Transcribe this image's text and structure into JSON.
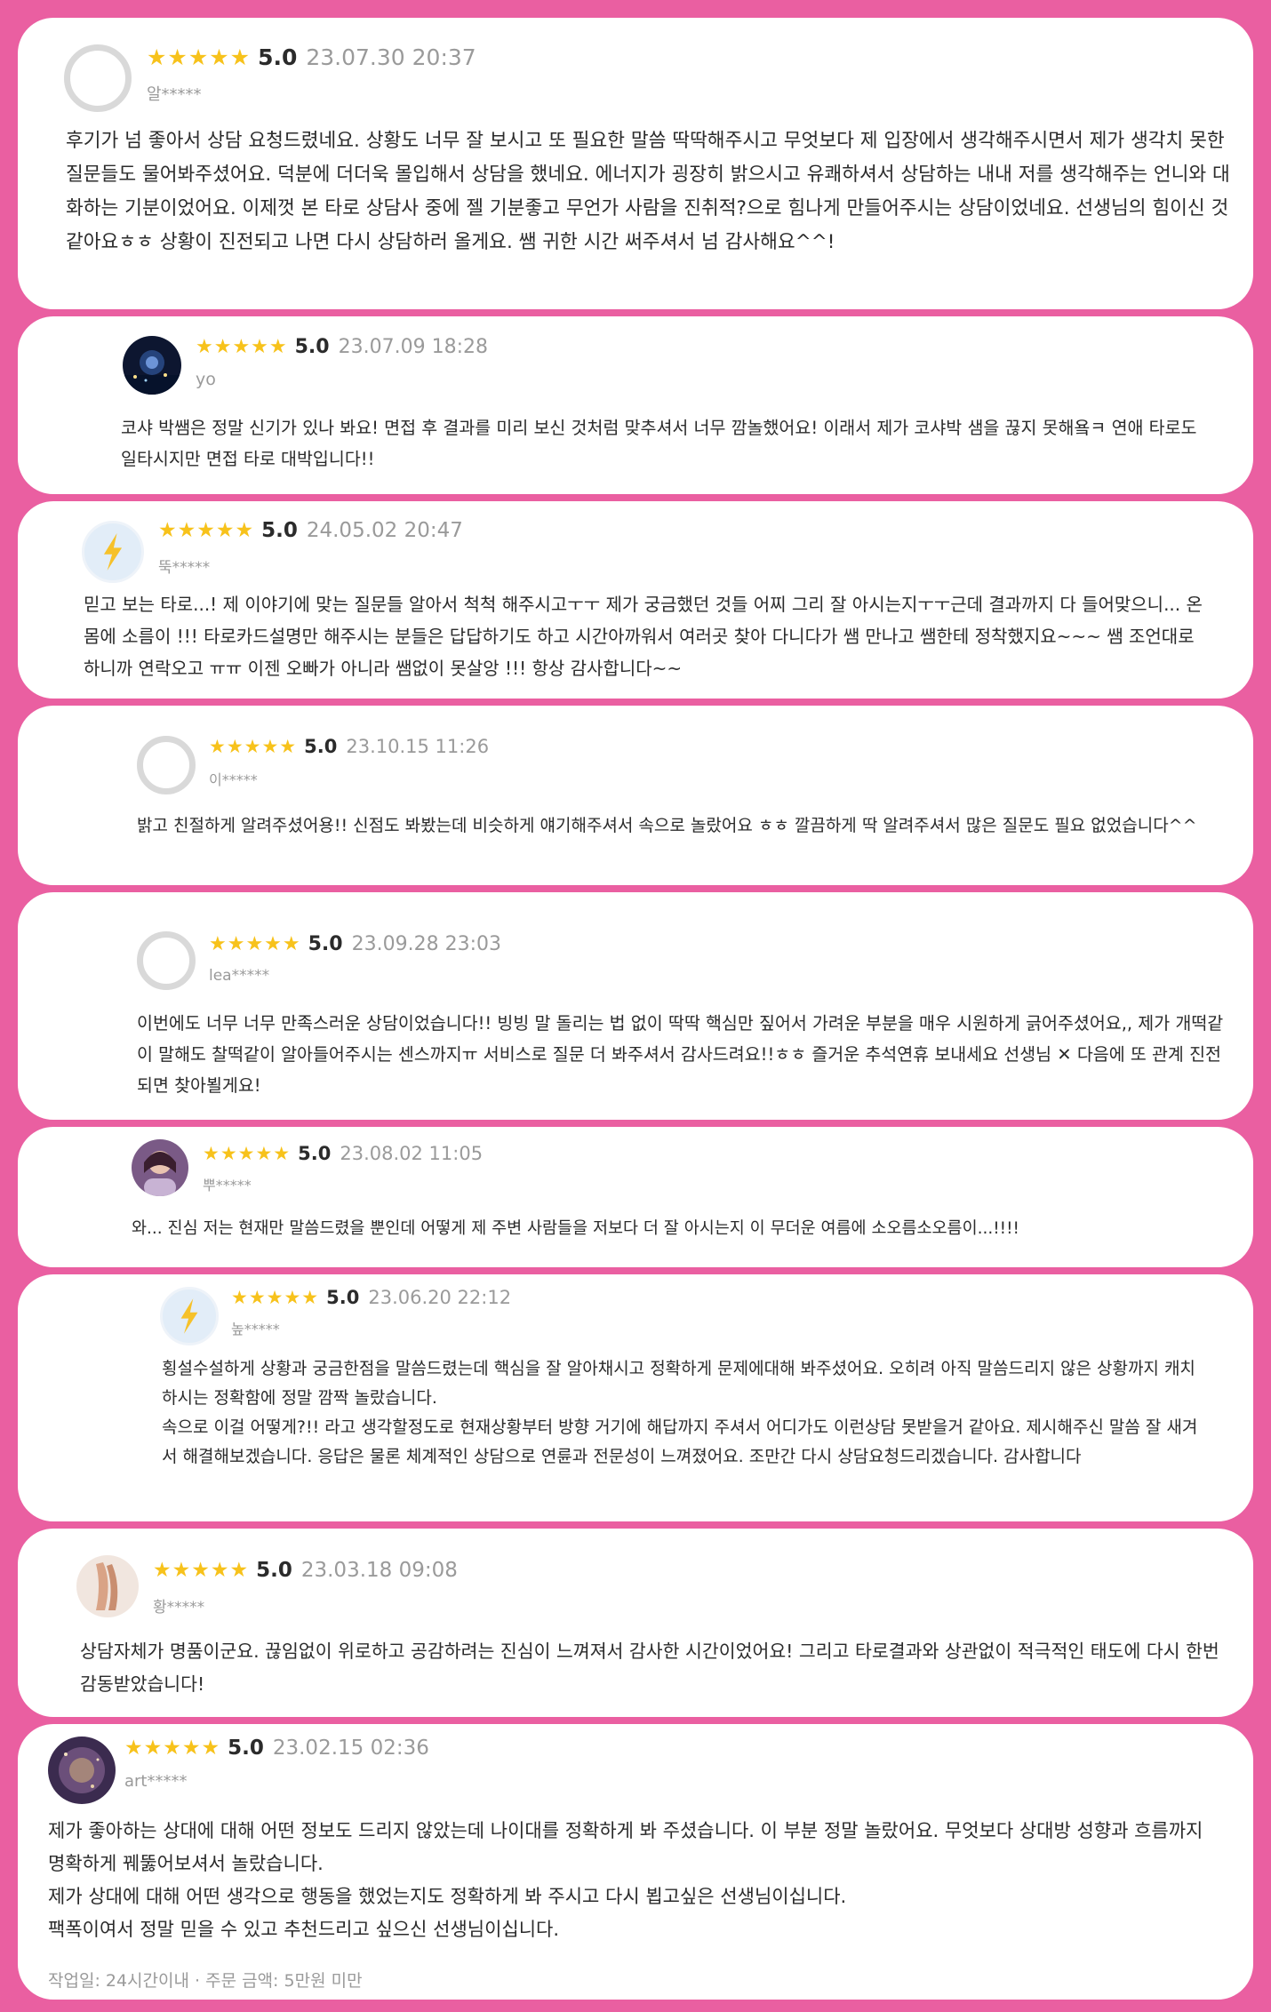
{
  "colors": {
    "page_background": "#ea5fa1",
    "card_background": "#ffffff",
    "star_color": "#f7c21b",
    "meta_gray": "#9a9a9a"
  },
  "reviews": [
    {
      "stars": "★★★★★",
      "rating": "5.0",
      "date": "23.07.30 20:37",
      "user": "알*****",
      "avatar": "default-avatar-icon",
      "text": "후기가 넘 좋아서 상담 요청드렸네요. 상황도 너무 잘 보시고 또 필요한 말씀 딱딱해주시고 무엇보다 제 입장에서 생각해주시면서 제가 생각치 못한 질문들도 물어봐주셨어요. 덕분에 더더욱 몰입해서 상담을 했네요. 에너지가 굉장히 밝으시고 유쾌하셔서 상담하는 내내 저를 생각해주는 언니와 대화하는 기분이었어요. 이제껏 본 타로 상담사 중에 젤 기분좋고 무언가 사람을 진취적?으로 힘나게 만들어주시는 상담이었네요. 선생님의 힘이신 것 같아요ㅎㅎ 상황이 진전되고 나면 다시 상담하러 올게요. 쌤 귀한 시간 써주셔서 넘 감사해요^^!"
    },
    {
      "stars": "★★★★★",
      "rating": "5.0",
      "date": "23.07.09 18:28",
      "user": "yo",
      "avatar": "night-city-photo-avatar",
      "text": "코샤 박쌤은 정말 신기가 있나 봐요! 면접 후 결과를 미리 보신 것처럼 맞추셔서 너무 깜놀했어요! 이래서 제가 코샤박 샘을 끊지 못해욬ㅋ 연애 타로도 일타시지만 면접 타로 대박입니다!!"
    },
    {
      "stars": "★★★★★",
      "rating": "5.0",
      "date": "24.05.02 20:47",
      "user": "뚝*****",
      "avatar": "lightning-bolt-icon",
      "text": "믿고 보는 타로...! 제 이야기에 맞는 질문들 알아서 척척 해주시고ㅜㅜ 제가 궁금했던 것들 어찌 그리 잘 아시는지ㅜㅜ근데 결과까지 다 들어맞으니... 온몸에 소름이 !!! 타로카드설명만 해주시는 분들은 답답하기도 하고 시간아까워서 여러곳 찾아 다니다가 쌤 만나고 쌤한테 정착했지요~~~ 쌤 조언대로 하니까 연락오고 ㅠㅠ 이젠 오빠가 아니라 쌤없이 못살앙 !!! 항상 감사합니다~~"
    },
    {
      "stars": "★★★★★",
      "rating": "5.0",
      "date": "23.10.15 11:26",
      "user": "이*****",
      "avatar": "default-avatar-icon",
      "text": "밝고 친절하게 알려주셨어용!! 신점도 봐봤는데 비슷하게 얘기해주셔서 속으로 놀랐어요 ㅎㅎ 깔끔하게 딱 알려주셔서 많은 질문도 필요 없었습니다^^"
    },
    {
      "stars": "★★★★★",
      "rating": "5.0",
      "date": "23.09.28 23:03",
      "user": "lea*****",
      "avatar": "default-avatar-icon",
      "text": "이번에도 너무 너무 만족스러운 상담이었습니다!! 빙빙 말 돌리는 법 없이 딱딱 핵심만 짚어서 가려운 부분을 매우 시원하게 긁어주셨어요,, 제가 개떡같이 말해도 찰떡같이 알아들어주시는 센스까지ㅠ 서비스로 질문 더 봐주셔서 감사드려요!!ㅎㅎ 즐거운 추석연휴 보내세요 선생님 ✕ 다음에 또 관계 진전되면 찾아뵐게요!"
    },
    {
      "stars": "★★★★★",
      "rating": "5.0",
      "date": "23.08.02 11:05",
      "user": "뿌*****",
      "avatar": "portrait-photo-avatar",
      "text": "와... 진심 저는 현재만 말씀드렸을 뿐인데 어떻게 제 주변 사람들을 저보다 더 잘 아시는지 이 무더운 여름에 소오름소오름이...!!!!"
    },
    {
      "stars": "★★★★★",
      "rating": "5.0",
      "date": "23.06.20 22:12",
      "user": "높*****",
      "avatar": "lightning-bolt-icon",
      "paragraphs": [
        "횡설수설하게 상황과 궁금한점을 말씀드렸는데 핵심을 잘 알아채시고 정확하게 문제에대해 봐주셨어요. 오히려 아직 말씀드리지 않은 상황까지 캐치하시는 정확함에 정말 깜짝 놀랐습니다.",
        "속으로 이걸 어떻게?!! 라고 생각할정도로 현재상황부터 방향 거기에 해답까지 주셔서 어디가도 이런상담 못받을거 같아요. 제시해주신 말씀 잘 새겨서 해결해보겠습니다. 응답은 물론 체계적인 상담으로 연륜과 전문성이 느껴졌어요. 조만간 다시 상담요청드리겠습니다. 감사합니다"
      ]
    },
    {
      "stars": "★★★★★",
      "rating": "5.0",
      "date": "23.03.18 09:08",
      "user": "황*****",
      "avatar": "hand-photo-avatar",
      "text": "상담자체가 명품이군요. 끊임없이 위로하고 공감하려는 진심이 느껴져서 감사한 시간이었어요! 그리고 타로결과와 상관없이 적극적인 태도에 다시 한번 감동받았습니다!"
    },
    {
      "stars": "★★★★★",
      "rating": "5.0",
      "date": "23.02.15 02:36",
      "user": "art*****",
      "avatar": "galaxy-photo-avatar",
      "paragraphs": [
        "제가 좋아하는 상대에 대해 어떤 정보도 드리지 않았는데 나이대를 정확하게 봐 주셨습니다. 이 부분 정말 놀랐어요. 무엇보다 상대방 성향과 흐름까지 명확하게 꿰뚫어보셔서 놀랐습니다.",
        "제가 상대에 대해 어떤 생각으로 행동을 했었는지도 정확하게 봐 주시고 다시 뵙고싶은 선생님이십니다.",
        "팩폭이여서 정말 믿을 수 있고 추천드리고 싶으신 선생님이십니다."
      ],
      "footer": "작업일: 24시간이내 · 주문 금액: 5만원 미만"
    }
  ]
}
